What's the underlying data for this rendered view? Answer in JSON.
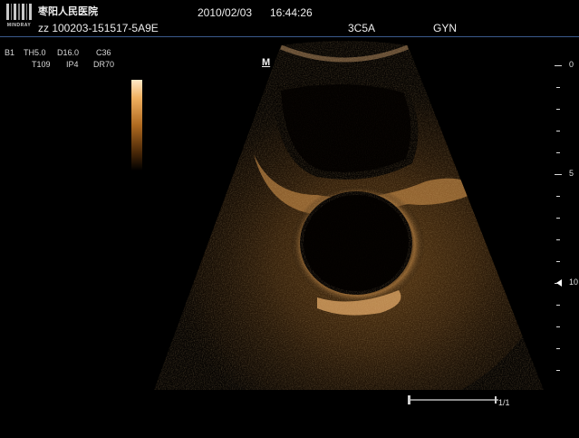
{
  "header": {
    "logo_brand": "MINDRAY",
    "hospital_name": "枣阳人民医院",
    "date": "2010/02/03",
    "time": "16:44:26",
    "patient_line": "zz 100203-151517-5A9E",
    "probe": "3C5A",
    "exam_type": "GYN"
  },
  "params": {
    "mode": "B1",
    "line1": [
      "TH5.0",
      "D16.0",
      "C36"
    ],
    "line2": [
      "T109",
      "IP4",
      "DR70"
    ]
  },
  "image": {
    "orientation_marker": "M"
  },
  "depth_scale": {
    "labels": [
      "0",
      "5",
      "10"
    ]
  },
  "cine": {
    "frame_counter": "1/1"
  },
  "colors": {
    "background": "#000000",
    "header_line": "#3a5a8c",
    "echo_tint": "#c98a3e"
  }
}
